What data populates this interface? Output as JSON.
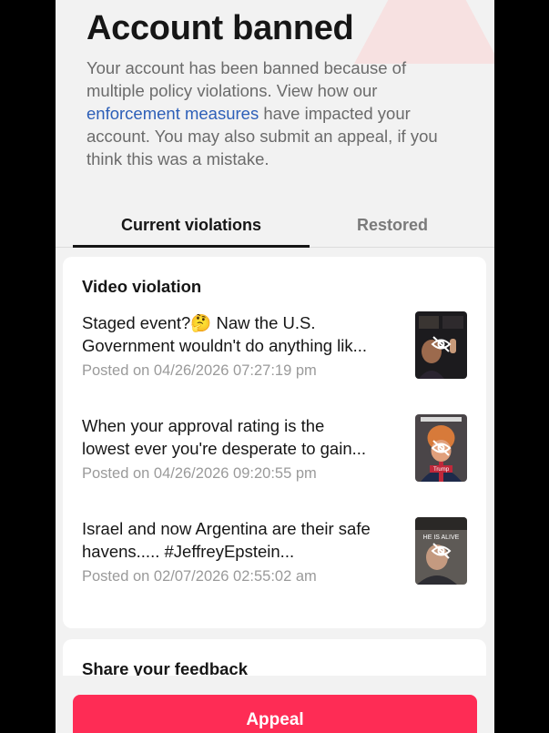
{
  "header": {
    "title": "Account banned",
    "desc_before": "Your account has been banned because of multiple policy violations. View how our ",
    "desc_link": "enforcement measures",
    "desc_after": " have impacted your account. You may also submit an appeal, if you think this was a mistake."
  },
  "tabs": [
    {
      "label": "Current violations",
      "active": true
    },
    {
      "label": "Restored",
      "active": false
    }
  ],
  "violations": {
    "section_title": "Video violation",
    "items": [
      {
        "line1": "Staged event?🤔 Naw the U.S.",
        "line2": "Government wouldn't do anything lik...",
        "date": "Posted on 04/26/2026 07:27:19 pm",
        "thumb_icon": "hidden-eye-icon"
      },
      {
        "line1": "When your approval rating is the",
        "line2": "lowest ever you're desperate to gain...",
        "date": "Posted on 04/26/2026 09:20:55 pm",
        "thumb_icon": "hidden-eye-icon",
        "thumb_caption": "Trump"
      },
      {
        "line1": "Israel and now Argentina are their safe",
        "line2": "havens..... #JeffreyEpstein...",
        "date": "Posted on 02/07/2026 02:55:02 am",
        "thumb_icon": "hidden-eye-icon",
        "thumb_caption": "HE IS ALIVE"
      }
    ]
  },
  "feedback": {
    "title": "Share your feedback"
  },
  "appeal_button": "Appeal",
  "colors": {
    "accent": "#fe2c55",
    "link": "#2d5fb8",
    "background": "#f2f2f2"
  }
}
